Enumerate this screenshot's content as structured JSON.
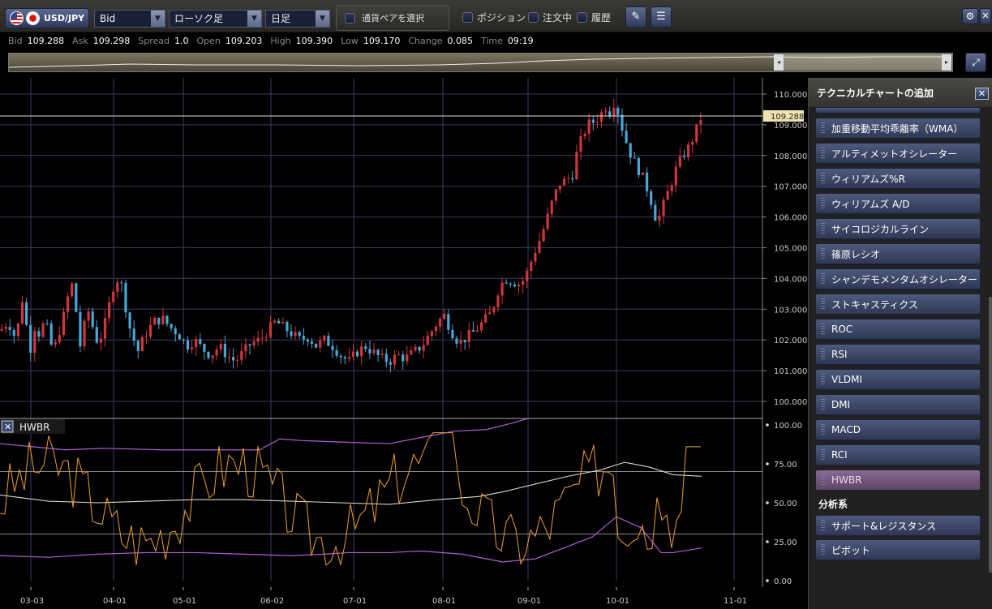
{
  "toolbar": {
    "pair": "USD/JPY",
    "price_type": "Bid",
    "chart_type": "ローソク足",
    "timeframe": "日足",
    "select_pair": "通貨ペアを選択",
    "checks": [
      "ポジション",
      "注文中",
      "履歴"
    ]
  },
  "quotes": [
    {
      "k": "Bid",
      "v": "109.288"
    },
    {
      "k": "Ask",
      "v": "109.298"
    },
    {
      "k": "Spread",
      "v": "1.0"
    },
    {
      "k": "Open",
      "v": "109.203"
    },
    {
      "k": "High",
      "v": "109.390"
    },
    {
      "k": "Low",
      "v": "109.170"
    },
    {
      "k": "Change",
      "v": "0.085"
    },
    {
      "k": "Time",
      "v": "09:19"
    }
  ],
  "chart_data": {
    "type": "candlestick",
    "price_ticks": [
      "110.000",
      "109.000",
      "108.000",
      "107.000",
      "106.000",
      "105.000",
      "104.000",
      "103.000",
      "102.000",
      "101.000",
      "100.000"
    ],
    "price_axis_range": [
      100,
      110
    ],
    "current_price": "109.288",
    "date_ticks": [
      "03-03",
      "04-01",
      "05-01",
      "06-02",
      "07-01",
      "08-01",
      "09-01",
      "10-01",
      "11-01"
    ],
    "candle_count": 170,
    "close_path": [
      [
        0,
        102.3
      ],
      [
        10,
        102.6
      ],
      [
        20,
        102.0
      ],
      [
        27,
        103.4
      ],
      [
        33,
        102.4
      ],
      [
        38,
        101.7
      ],
      [
        44,
        102.6
      ],
      [
        50,
        102.0
      ],
      [
        55,
        102.8
      ],
      [
        60,
        102.1
      ],
      [
        66,
        101.6
      ],
      [
        72,
        102.2
      ],
      [
        77,
        102.6
      ],
      [
        82,
        103.2
      ],
      [
        88,
        103.9
      ],
      [
        93,
        103.1
      ],
      [
        99,
        101.8
      ],
      [
        105,
        102.6
      ],
      [
        110,
        103.0
      ],
      [
        116,
        102.2
      ],
      [
        121,
        101.9
      ],
      [
        127,
        102.3
      ],
      [
        132,
        102.8
      ],
      [
        138,
        103.6
      ],
      [
        143,
        104.0
      ],
      [
        149,
        103.9
      ],
      [
        154,
        103.2
      ],
      [
        160,
        102.4
      ],
      [
        165,
        102.0
      ],
      [
        171,
        101.6
      ],
      [
        176,
        102.0
      ],
      [
        182,
        102.3
      ],
      [
        190,
        102.6
      ],
      [
        200,
        102.7
      ],
      [
        210,
        102.4
      ],
      [
        220,
        102.2
      ],
      [
        230,
        101.8
      ],
      [
        240,
        102.0
      ],
      [
        250,
        101.7
      ],
      [
        260,
        101.5
      ],
      [
        270,
        101.8
      ],
      [
        280,
        101.5
      ],
      [
        290,
        101.3
      ],
      [
        300,
        101.6
      ],
      [
        310,
        101.9
      ],
      [
        320,
        102.0
      ],
      [
        330,
        102.3
      ],
      [
        340,
        102.6
      ],
      [
        350,
        102.4
      ],
      [
        360,
        102.2
      ],
      [
        370,
        102.0
      ],
      [
        380,
        102.1
      ],
      [
        390,
        101.8
      ],
      [
        400,
        102.0
      ],
      [
        410,
        101.8
      ],
      [
        420,
        101.5
      ],
      [
        430,
        101.3
      ],
      [
        440,
        101.6
      ],
      [
        450,
        101.8
      ],
      [
        460,
        101.6
      ],
      [
        470,
        101.4
      ],
      [
        480,
        101.3
      ],
      [
        490,
        101.5
      ],
      [
        500,
        101.4
      ],
      [
        510,
        101.6
      ],
      [
        520,
        101.8
      ],
      [
        530,
        102.2
      ],
      [
        540,
        102.6
      ],
      [
        548,
        102.8
      ],
      [
        556,
        102.3
      ],
      [
        566,
        101.9
      ],
      [
        576,
        102.1
      ],
      [
        586,
        102.3
      ],
      [
        596,
        102.6
      ],
      [
        606,
        102.9
      ],
      [
        614,
        103.6
      ],
      [
        622,
        104.0
      ],
      [
        632,
        103.9
      ],
      [
        642,
        103.8
      ],
      [
        650,
        104.2
      ],
      [
        658,
        104.8
      ],
      [
        666,
        105.3
      ],
      [
        674,
        105.9
      ],
      [
        682,
        106.6
      ],
      [
        690,
        107.1
      ],
      [
        698,
        107.2
      ],
      [
        706,
        107.4
      ],
      [
        712,
        108.2
      ],
      [
        718,
        108.6
      ],
      [
        724,
        109.0
      ],
      [
        732,
        109.1
      ],
      [
        740,
        109.3
      ],
      [
        746,
        109.6
      ],
      [
        752,
        109.4
      ],
      [
        758,
        109.8
      ],
      [
        764,
        109.2
      ],
      [
        770,
        108.6
      ],
      [
        778,
        108.0
      ],
      [
        786,
        107.6
      ],
      [
        794,
        107.2
      ],
      [
        802,
        106.6
      ],
      [
        810,
        105.8
      ],
      [
        818,
        106.4
      ],
      [
        826,
        107.0
      ],
      [
        834,
        107.6
      ],
      [
        842,
        108.0
      ],
      [
        850,
        108.3
      ],
      [
        858,
        108.8
      ],
      [
        865,
        109.3
      ]
    ],
    "indicator": {
      "name": "HWBR",
      "y_ticks": [
        "100.00",
        "75.00",
        "50.00",
        "25.00",
        "0.00"
      ],
      "y_range": [
        0,
        100
      ],
      "levels": [
        70,
        30
      ],
      "series_colors": {
        "upper": "#b05cd8",
        "lower": "#b05cd8",
        "mid": "#d8d8c8",
        "fast": "#f0a028"
      }
    }
  },
  "panel": {
    "title": "テクニカルチャートの追加",
    "items": [
      "加重移動平均乖離率（WMA）",
      "アルティメットオシレーター",
      "ウィリアムズ%R",
      "ウィリアムズ A/D",
      "サイコロジカルライン",
      "篠原レシオ",
      "シャンデモメンタムオシレーター",
      "ストキャスティクス",
      "ROC",
      "RSI",
      "VLDMI",
      "DMI",
      "MACD",
      "RCI",
      "HWBR"
    ],
    "selected": "HWBR",
    "section": "分析系",
    "section_items": [
      "サポート&レジスタンス",
      "ピボット"
    ]
  },
  "colors": {
    "up": "#d0363a",
    "down": "#4aa6d6",
    "grid": "#3a3a66"
  }
}
